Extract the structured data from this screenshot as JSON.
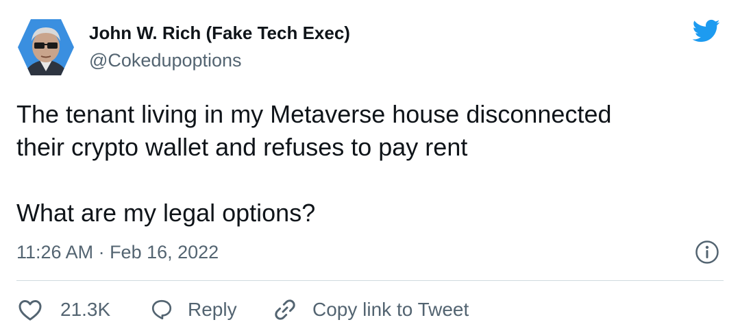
{
  "author": {
    "name": "John W. Rich (Fake Tech Exec)",
    "handle": "@Cokedupoptions"
  },
  "tweet": {
    "line1": "The tenant living in my Metaverse house disconnected",
    "line2": "their crypto wallet and refuses to pay rent",
    "line3": "What are my legal options?",
    "timestamp": "11:26 AM · Feb 16, 2022"
  },
  "actions": {
    "like_count": "21.3K",
    "reply_label": "Reply",
    "copy_label": "Copy link to Tweet"
  },
  "icons": {
    "brand": "twitter-bird-icon",
    "info": "info-icon",
    "like": "heart-icon",
    "reply": "reply-bubble-icon",
    "copy": "link-icon"
  },
  "colors": {
    "brand_blue": "#1d9bf0",
    "text_primary": "#0f1419",
    "text_secondary": "#536471",
    "divider": "#cfd9de"
  }
}
